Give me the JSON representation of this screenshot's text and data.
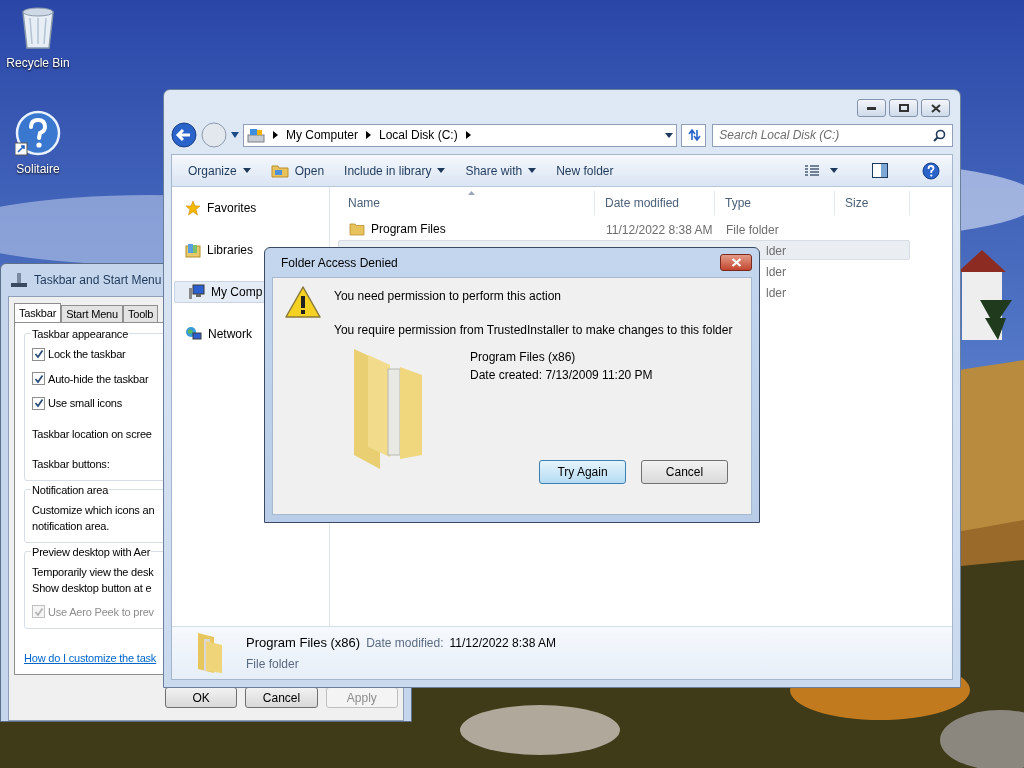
{
  "desktop_icons": [
    {
      "label": "Recycle Bin",
      "kind": "recycle"
    },
    {
      "label": "Solitaire",
      "kind": "help"
    }
  ],
  "taskbar_properties": {
    "title": "Taskbar and Start Menu",
    "tabs": [
      {
        "label": "Taskbar",
        "selected": true
      },
      {
        "label": "Start Menu",
        "selected": false
      },
      {
        "label": "Toolb",
        "selected": false
      }
    ],
    "groups": [
      {
        "legend": "Taskbar appearance",
        "items": [
          {
            "kind": "checkbox",
            "label": "Lock the taskbar",
            "checked": true,
            "disabled": false
          },
          {
            "kind": "checkbox",
            "label": "Auto-hide the taskbar",
            "checked": true,
            "disabled": false
          },
          {
            "kind": "checkbox",
            "label": "Use small icons",
            "checked": true,
            "disabled": false
          },
          {
            "kind": "text",
            "lines": [
              "Taskbar location on scree"
            ]
          },
          {
            "kind": "text",
            "lines": [
              "Taskbar buttons:"
            ]
          }
        ]
      },
      {
        "legend": "Notification area",
        "items": [
          {
            "kind": "text",
            "lines": [
              "Customize which icons an",
              "notification area."
            ]
          }
        ]
      },
      {
        "legend": "Preview desktop with Aer",
        "items": [
          {
            "kind": "text",
            "lines": [
              "Temporarily view the desk",
              "Show desktop button at e"
            ]
          },
          {
            "kind": "checkbox",
            "label": "Use Aero Peek to prev",
            "checked": true,
            "disabled": true
          }
        ]
      }
    ],
    "help_link": "How do I customize the task",
    "buttons": [
      {
        "label": "OK",
        "disabled": false
      },
      {
        "label": "Cancel",
        "disabled": false
      },
      {
        "label": "Apply",
        "disabled": true
      }
    ]
  },
  "explorer": {
    "breadcrumb": [
      "My Computer",
      "Local Disk (C:)"
    ],
    "search_placeholder": "Search Local Disk (C:)",
    "toolbar": [
      {
        "label": "Organize",
        "icon": false,
        "dropdown": true
      },
      {
        "label": "Open",
        "icon": true,
        "dropdown": false
      },
      {
        "label": "Include in library",
        "icon": false,
        "dropdown": true
      },
      {
        "label": "Share with",
        "icon": false,
        "dropdown": true
      },
      {
        "label": "New folder",
        "icon": false,
        "dropdown": false
      }
    ],
    "nav": [
      {
        "label": "Favorites",
        "kind": "star",
        "selected": false
      },
      {
        "label": "Libraries",
        "kind": "library",
        "selected": false
      },
      {
        "label": "My Comp",
        "kind": "computer",
        "selected": true
      },
      {
        "label": "Network",
        "kind": "network",
        "selected": false
      }
    ],
    "columns": [
      "Name",
      "Date modified",
      "Type",
      "Size"
    ],
    "rows": [
      {
        "name": "Program Files",
        "date": "11/12/2022 8:38 AM",
        "type": "File folder",
        "selected": false
      },
      {
        "type": "lder",
        "selected": true
      },
      {
        "type": "lder",
        "selected": false
      },
      {
        "type": "lder",
        "selected": false
      }
    ],
    "details": {
      "name": "Program Files (x86)",
      "date_label": "Date modified:",
      "date": "11/12/2022 8:38 AM",
      "type": "File folder"
    }
  },
  "dialog": {
    "title": "Folder Access Denied",
    "heading": "You need permission to perform this action",
    "message": "You require permission from TrustedInstaller to make changes to this folder",
    "item_name": "Program Files (x86)",
    "item_date": "Date created: 7/13/2009 11:20 PM",
    "buttons": [
      {
        "label": "Try Again",
        "selected": true
      },
      {
        "label": "Cancel",
        "selected": false
      }
    ]
  }
}
